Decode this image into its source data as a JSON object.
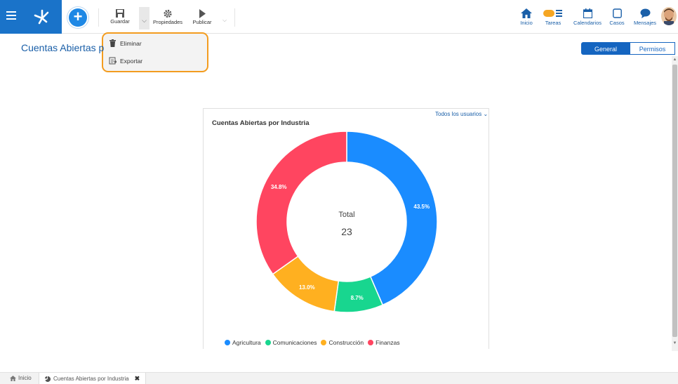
{
  "toolbar": {
    "save_label": "Guardar",
    "properties_label": "Propiedades",
    "publish_label": "Publicar"
  },
  "right_nav": {
    "home_label": "Inicio",
    "tasks_label": "Tareas",
    "calendars_label": "Calendarios",
    "cases_label": "Casos",
    "messages_label": "Mensajes"
  },
  "dropdown": {
    "items": [
      {
        "label": "Eliminar",
        "icon": "trash-icon"
      },
      {
        "label": "Exportar",
        "icon": "export-icon"
      }
    ]
  },
  "page": {
    "title": "Cuentas Abiertas p",
    "tabs": [
      {
        "label": "General",
        "active": true
      },
      {
        "label": "Permisos",
        "active": false
      }
    ]
  },
  "card": {
    "user_filter": "Todos los usuarios"
  },
  "chart_data": {
    "type": "pie",
    "title": "Cuentas Abiertas por Industria",
    "center_label": "Total",
    "center_value": "23",
    "legend_position": "bottom",
    "slices": [
      {
        "name": "Agricultura",
        "percent": 43.5,
        "label": "43.5%",
        "color": "#1a8cff"
      },
      {
        "name": "Comunicaciones",
        "percent": 8.7,
        "label": "8.7%",
        "color": "#18d68f"
      },
      {
        "name": "Construcción",
        "percent": 13.0,
        "label": "13.0%",
        "color": "#ffb020"
      },
      {
        "name": "Finanzas",
        "percent": 34.8,
        "label": "34.8%",
        "color": "#ff4560"
      }
    ]
  },
  "bottom_bar": {
    "home_label": "Inicio",
    "tab_label": "Cuentas Abiertas por Industria"
  },
  "colors": {
    "brand": "#1a73c9",
    "accent": "#1565c0",
    "highlight_border": "#f39c1f"
  }
}
